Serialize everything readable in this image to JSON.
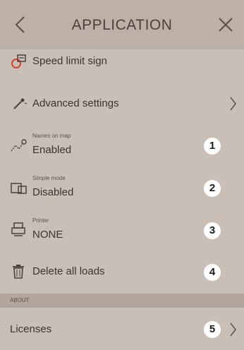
{
  "header": {
    "title": "APPLICATION",
    "back_icon": "chevron-left-icon",
    "close_icon": "close-icon"
  },
  "items": [
    {
      "label": "Speed limit sign",
      "icon": "speed-limit-sign-icon"
    },
    {
      "label": "Advanced settings",
      "icon": "wand-icon"
    },
    {
      "caption": "Names on map",
      "value": "Enabled",
      "badge": "1",
      "icon": "map-names-icon"
    },
    {
      "caption": "Simple mode",
      "value": "Disabled",
      "badge": "2",
      "icon": "simple-mode-icon"
    },
    {
      "caption": "Printer",
      "value": "NONE",
      "badge": "3",
      "icon": "printer-icon"
    },
    {
      "label": "Delete all loads",
      "badge": "4",
      "icon": "trash-icon"
    }
  ],
  "about": {
    "header": "ABOUT",
    "licenses_label": "Licenses",
    "licenses_badge": "5"
  },
  "colors": {
    "background": "#c9bfb6",
    "header": "#bdb1a7",
    "badge": "#ffffff",
    "speed_sign_red": "#d8402e"
  }
}
